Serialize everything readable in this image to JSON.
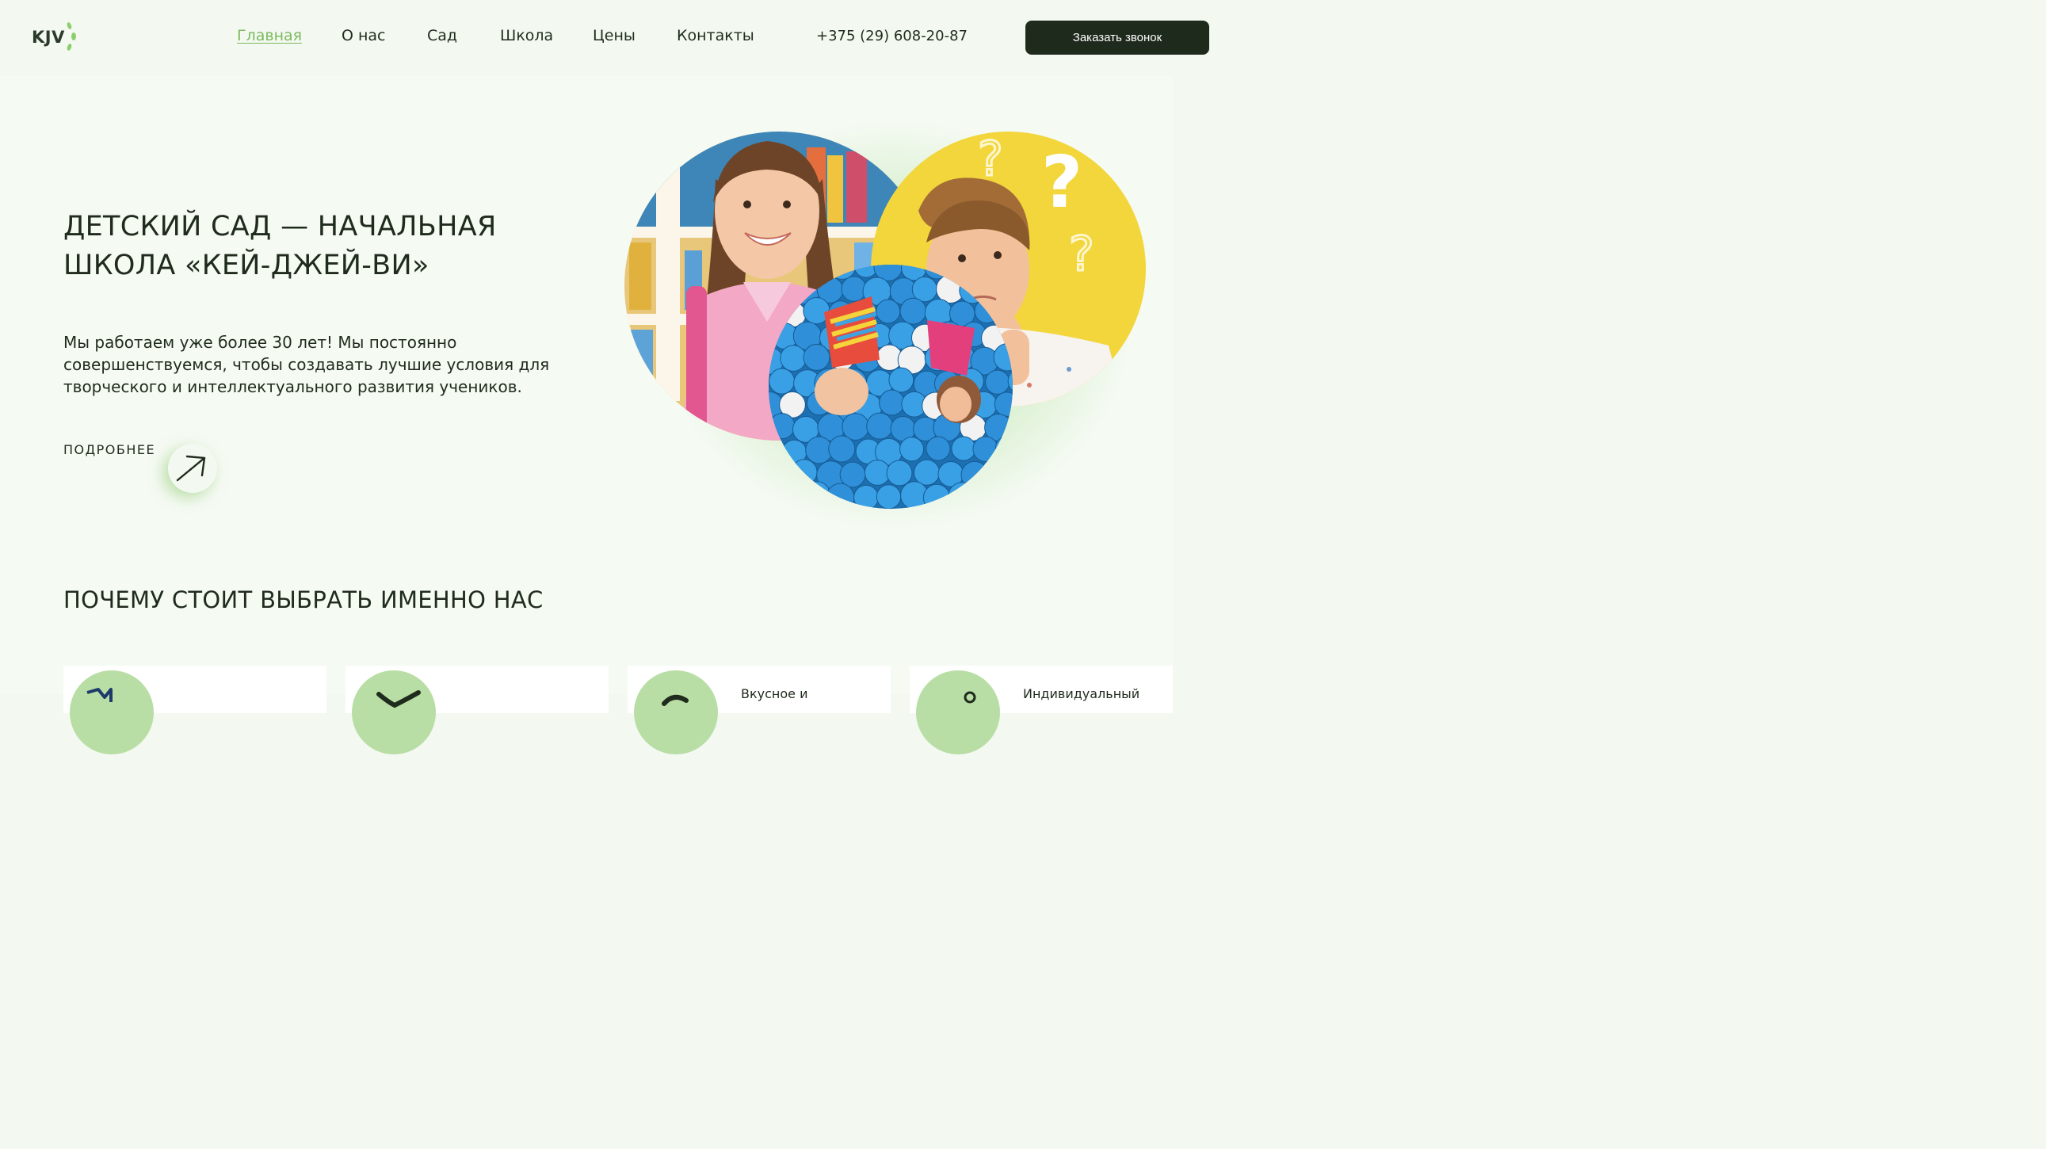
{
  "header": {
    "logo_text": "KJV",
    "nav": [
      {
        "label": "Главная",
        "active": true
      },
      {
        "label": "О нас",
        "active": false
      },
      {
        "label": "Сад",
        "active": false
      },
      {
        "label": "Школа",
        "active": false
      },
      {
        "label": "Цены",
        "active": false
      },
      {
        "label": "Контакты",
        "active": false
      }
    ],
    "phone": "+375 (29) 608-20-87",
    "call_button": "Заказать звонок"
  },
  "hero": {
    "title": "ДЕТСКИЙ САД — НАЧАЛЬНАЯ ШКОЛА «КЕЙ-ДЖЕЙ-ВИ»",
    "text": "Мы работаем уже более 30 лет! Мы постоянно совершенствуемся, чтобы создавать лучшие условия для творческого и интеллектуального развития учеников.",
    "more_label": "ПОДРОБНЕЕ",
    "more_icon": "arrow-up-right-icon",
    "photos": [
      {
        "name": "photo-girl-with-backpack"
      },
      {
        "name": "photo-thinking-boy"
      },
      {
        "name": "photo-kids-in-ball-pit"
      }
    ]
  },
  "why": {
    "title": "ПОЧЕМУ СТОИТ ВЫБРАТЬ ИМЕННО НАС",
    "cards": [
      {
        "title": "",
        "icon": "book-icon"
      },
      {
        "title": "",
        "icon": "bird-icon"
      },
      {
        "title": "Вкусное и",
        "icon": "food-icon"
      },
      {
        "title": "Индивидуальный",
        "icon": "person-icon"
      }
    ]
  },
  "colors": {
    "background": "#f3f9f1",
    "accent_green": "#7cb95e",
    "dark_button": "#1e2a1c",
    "text": "#1f2b1c",
    "yellow": "#f2d63c",
    "ball_blue": "#2f8fd8"
  }
}
